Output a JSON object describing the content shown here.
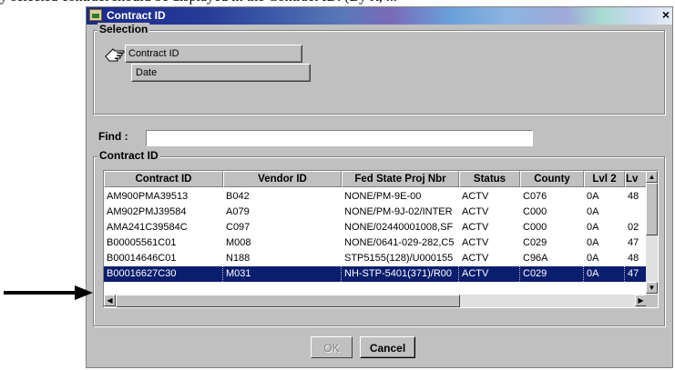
{
  "page_fragment": "y selected contract should be displayed in the Contract ID. (By rt, ...",
  "window": {
    "title": "Contract ID",
    "close": "×"
  },
  "selection": {
    "legend": "Selection",
    "options": [
      "Contract ID",
      "Date"
    ]
  },
  "find": {
    "label": "Find :",
    "value": ""
  },
  "contract_group": {
    "legend": "Contract ID"
  },
  "table": {
    "columns": [
      "Contract ID",
      "Vendor ID",
      "Fed State Proj Nbr",
      "Status",
      "County",
      "Lvl 2",
      "Lv"
    ],
    "rows": [
      [
        "AM900PMA39513",
        "B042",
        "NONE/PM-9E-00",
        "ACTV",
        "C076",
        "0A",
        "48"
      ],
      [
        "AM902PMJ39584",
        "A079",
        "NONE/PM-9J-02/INTER",
        "ACTV",
        "C000",
        "0A",
        ""
      ],
      [
        "AMA241C39584C",
        "C097",
        "NONE/02440001008,SF",
        "ACTV",
        "C000",
        "0A",
        "02"
      ],
      [
        "B00005561C01",
        "M008",
        "NONE/0641-029-282,C5",
        "ACTV",
        "C029",
        "0A",
        "47"
      ],
      [
        "B00014646C01",
        "N188",
        "STP5155(128)/U000155",
        "ACTV",
        "C96A",
        "0A",
        "48"
      ],
      [
        "B00016627C30",
        "M031",
        "NH-STP-5401(371)/R00",
        "ACTV",
        "C029",
        "0A",
        "47"
      ]
    ],
    "selected_row_index": 5
  },
  "buttons": {
    "ok": "OK",
    "cancel": "Cancel"
  },
  "colors": {
    "selection": "#0a1d6e",
    "dialog": "#c0c0c0"
  }
}
